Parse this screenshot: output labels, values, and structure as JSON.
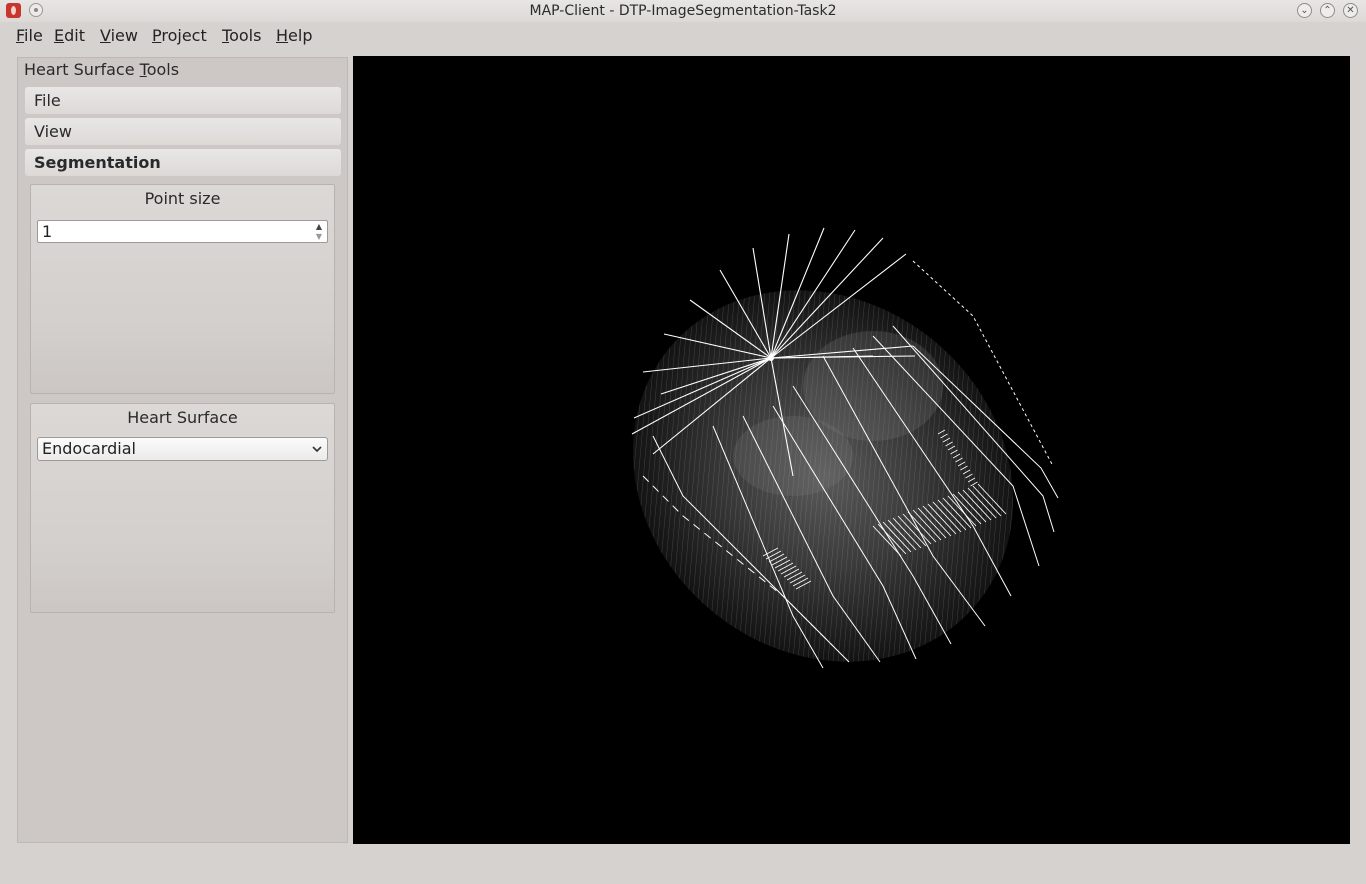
{
  "window": {
    "title": "MAP-Client - DTP-ImageSegmentation-Task2",
    "controls": [
      "minimize",
      "maximize",
      "close"
    ]
  },
  "menubar": {
    "items": [
      {
        "label": "File",
        "mnemonic": "F",
        "rest": "ile"
      },
      {
        "label": "Edit",
        "mnemonic": "E",
        "rest": "dit"
      },
      {
        "label": "View",
        "mnemonic": "V",
        "rest": "iew"
      },
      {
        "label": "Project",
        "mnemonic": "P",
        "rest": "roject"
      },
      {
        "label": "Tools",
        "mnemonic": "T",
        "rest": "ools"
      },
      {
        "label": "Help",
        "mnemonic": "H",
        "rest": "elp"
      }
    ]
  },
  "side_panel": {
    "title_prefix": "Heart Surface ",
    "title_mnemonic": "T",
    "title_rest": "ools",
    "tabs": [
      {
        "label": "File",
        "active": false
      },
      {
        "label": "View",
        "active": false
      },
      {
        "label": "Segmentation",
        "active": true
      }
    ],
    "point_size": {
      "label": "Point size",
      "value": "1"
    },
    "heart_surface": {
      "label": "Heart Surface",
      "selected": "Endocardial"
    }
  },
  "viewport": {
    "background": "#000000",
    "content": "3D rendering of stacked MRI image planes radiating around a central axis"
  },
  "colors": {
    "window_bg": "#d6d2d0",
    "panel_bg": "#cdc8c5",
    "accent_red": "#c8372d"
  }
}
